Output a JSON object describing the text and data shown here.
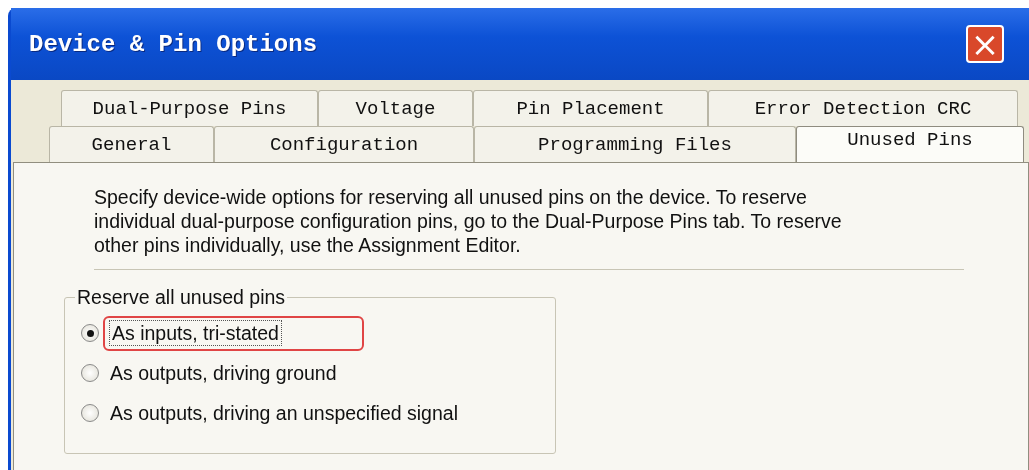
{
  "window": {
    "title": "Device & Pin Options",
    "close_button": "×"
  },
  "tab_rows": [
    {
      "tabs": [
        {
          "label": "Dual-Purpose Pins",
          "selected": false
        },
        {
          "label": "Voltage",
          "selected": false
        },
        {
          "label": "Pin Placement",
          "selected": false
        },
        {
          "label": "Error Detection CRC",
          "selected": false
        }
      ]
    },
    {
      "tabs": [
        {
          "label": "General",
          "selected": false
        },
        {
          "label": "Configuration",
          "selected": false
        },
        {
          "label": "Programming Files",
          "selected": false
        },
        {
          "label": "Unused Pins",
          "selected": true
        }
      ]
    }
  ],
  "description": "Specify device-wide options for reserving all unused pins on the device. To reserve individual dual-purpose configuration pins, go to the Dual-Purpose Pins tab. To reserve other pins individually, use the Assignment Editor.",
  "group": {
    "title": "Reserve all unused pins",
    "options": [
      {
        "label": "As inputs, tri-stated",
        "selected": true,
        "highlighted": true
      },
      {
        "label": "As outputs, driving ground",
        "selected": false,
        "highlighted": false
      },
      {
        "label": "As outputs, driving an unspecified signal",
        "selected": false,
        "highlighted": false
      }
    ]
  }
}
